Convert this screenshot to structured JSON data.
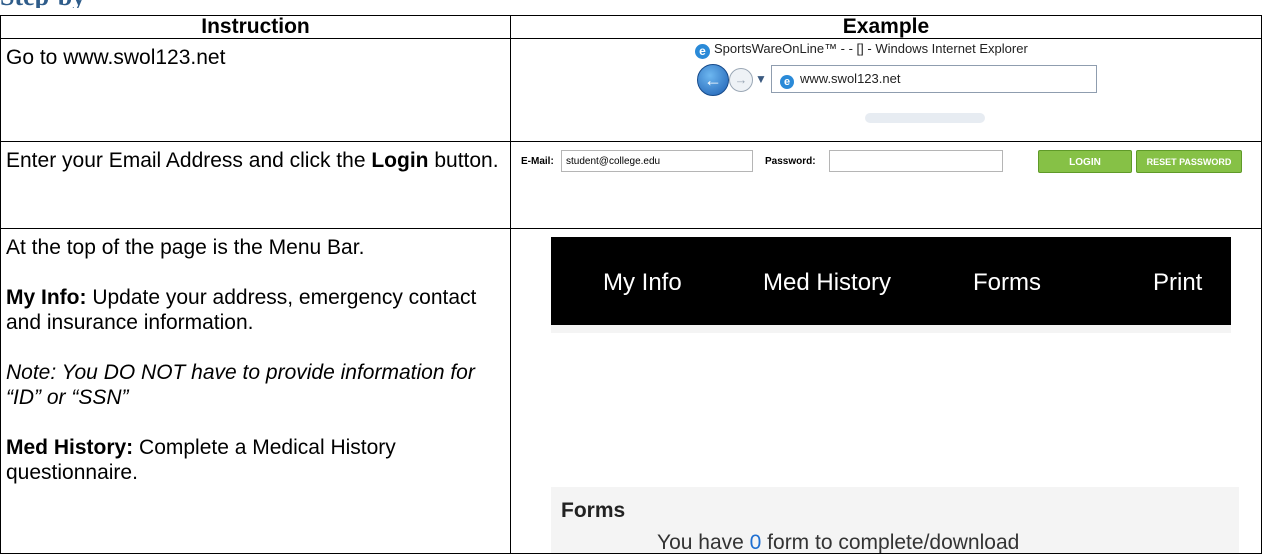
{
  "heading_fragment": "Step-by",
  "table": {
    "col_instruction": "Instruction",
    "col_example": "Example",
    "rows": [
      {
        "instruction": "Go to www.swol123.net"
      },
      {
        "instruction_pre": "Enter your Email Address and click the ",
        "instruction_bold": "Login",
        "instruction_post": " button."
      },
      {
        "line1": "At the top of the page is the Menu Bar.",
        "myinfo_label": "My Info:",
        "myinfo_text": " Update your address, emergency contact and insurance information.",
        "note": "Note: You DO NOT have to provide information for “ID” or “SSN”",
        "medhist_label": "Med History:",
        "medhist_text": " Complete a Medical History questionnaire."
      }
    ]
  },
  "browser": {
    "title": "SportsWareOnLine™ - - [] - Windows Internet Explorer",
    "address": "www.swol123.net",
    "icon": "ie-logo-icon"
  },
  "login": {
    "email_label": "E-Mail:",
    "email_value": "student@college.edu",
    "password_label": "Password:",
    "password_value": "",
    "login_button": "Login",
    "reset_button": "Reset Password",
    "button_color": "#86c146"
  },
  "menu": {
    "items": [
      "My Info",
      "Med History",
      "Forms",
      "Print"
    ],
    "background": "#000000"
  },
  "forms": {
    "title": "Forms",
    "text_pre": "You have ",
    "count": "0",
    "text_post": " form to complete/download",
    "count_color": "#1f6fd1"
  }
}
